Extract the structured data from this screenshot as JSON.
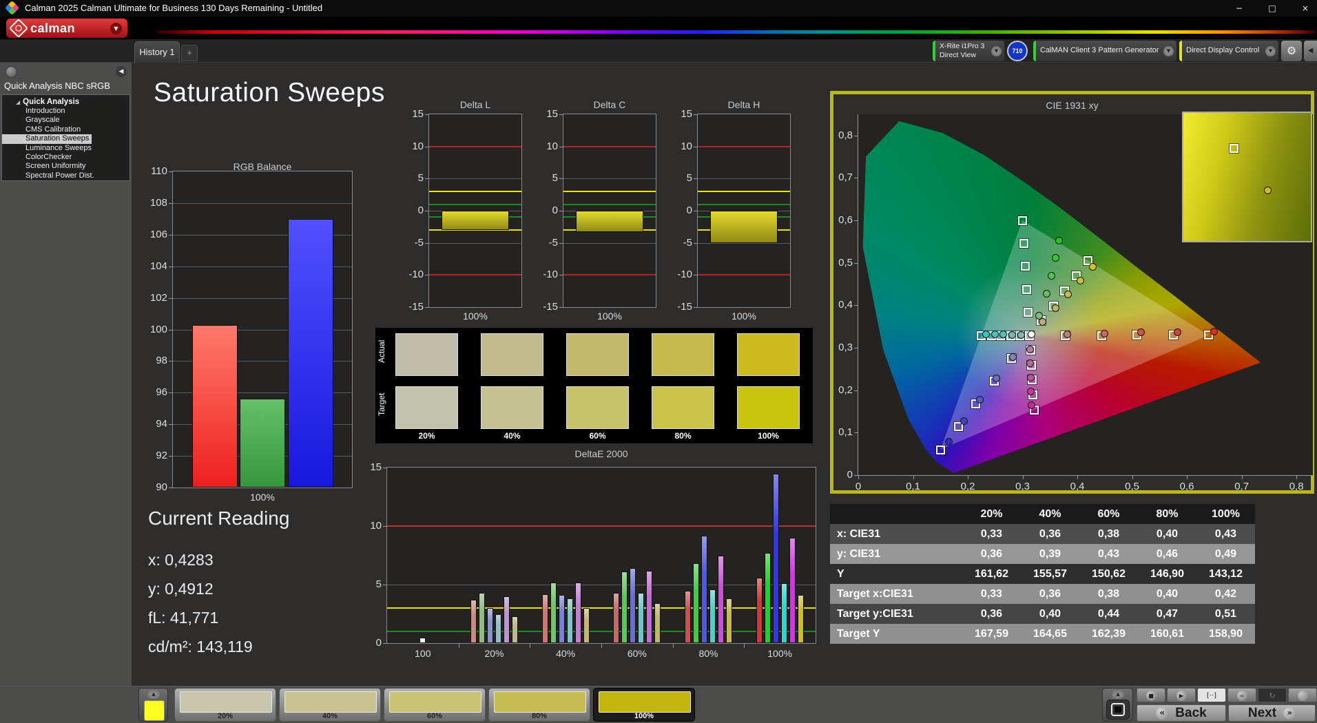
{
  "window": {
    "title": "Calman 2025 Calman Ultimate for Business 130 Days Remaining  - Untitled",
    "controls": {
      "minimize": "−",
      "maximize": "□",
      "close": "×"
    }
  },
  "brand": {
    "logo_text": "calman",
    "dropdown": "▼"
  },
  "toolbar": {
    "tab": "History 1",
    "tab_add": "+",
    "meter": {
      "line1": "X-Rite i1Pro 3",
      "line2": "Direct View",
      "accent": "#2fd32f",
      "dropdown": "▼"
    },
    "meter_badge": "710",
    "source": {
      "label": "CalMAN Client 3 Pattern Generator",
      "accent": "#2fd32f",
      "dropdown": "▼"
    },
    "display": {
      "label": "Direct Display Control",
      "accent": "#e3e32b",
      "dropdown": "▼"
    },
    "gear": "⚙",
    "edge_arrow": "◀"
  },
  "sidebar": {
    "collapse_arrow": "◀",
    "workflow_title": "Quick Analysis NBC sRGB",
    "root": "Quick Analysis",
    "items": [
      {
        "label": "Introduction",
        "selected": false
      },
      {
        "label": "Grayscale",
        "selected": false
      },
      {
        "label": "CMS Calibration",
        "selected": false
      },
      {
        "label": "Saturation Sweeps",
        "selected": true
      },
      {
        "label": "Luminance Sweeps",
        "selected": false
      },
      {
        "label": "ColorChecker",
        "selected": false
      },
      {
        "label": "Screen Uniformity",
        "selected": false
      },
      {
        "label": "Spectral Power Dist.",
        "selected": false
      }
    ]
  },
  "page": {
    "title": "Saturation Sweeps"
  },
  "current_reading": {
    "heading": "Current Reading",
    "lines": [
      "x: 0,4283",
      "y: 0,4912",
      "fL: 41,771",
      "cd/m²: 143,119"
    ]
  },
  "swatch_matrix": {
    "row_labels": [
      "Actual",
      "Target"
    ],
    "column_labels": [
      "20%",
      "40%",
      "60%",
      "80%",
      "100%"
    ],
    "actual_colors": [
      "#c0bda6",
      "#c2bc8d",
      "#c3b86a",
      "#c6ba4c",
      "#ccb91f"
    ],
    "target_colors": [
      "#c4c3ac",
      "#c5c192",
      "#c7c36a",
      "#cac44a",
      "#c9c40e"
    ]
  },
  "table": {
    "columns": [
      "20%",
      "40%",
      "60%",
      "80%",
      "100%"
    ],
    "rows": [
      {
        "label": "x: CIE31",
        "values": [
          "0,33",
          "0,36",
          "0,38",
          "0,40",
          "0,43"
        ],
        "bg": "#4d4d4d"
      },
      {
        "label": "y: CIE31",
        "values": [
          "0,36",
          "0,39",
          "0,43",
          "0,46",
          "0,49"
        ],
        "bg": "#969696"
      },
      {
        "label": "Y",
        "values": [
          "161,62",
          "155,57",
          "150,62",
          "146,90",
          "143,12"
        ],
        "bg": "#2e2e2e"
      },
      {
        "label": "Target x:CIE31",
        "values": [
          "0,33",
          "0,36",
          "0,38",
          "0,40",
          "0,42"
        ],
        "bg": "#8f8f8f"
      },
      {
        "label": "Target y:CIE31",
        "values": [
          "0,36",
          "0,40",
          "0,44",
          "0,47",
          "0,51"
        ],
        "bg": "#454545"
      },
      {
        "label": "Target Y",
        "values": [
          "167,59",
          "164,65",
          "162,39",
          "160,61",
          "158,90"
        ],
        "bg": "#909090"
      }
    ]
  },
  "chart_data": [
    {
      "id": "rgb_balance",
      "type": "bar",
      "title": "RGB Balance",
      "xlabel": "100%",
      "categories": [
        "Red",
        "Green",
        "Blue"
      ],
      "values": [
        100.3,
        95.6,
        107.0
      ],
      "bar_gradients": [
        [
          "#ff7a6a",
          "#ee2020"
        ],
        [
          "#64c06a",
          "#35983c"
        ],
        [
          "#5050ff",
          "#1818dd"
        ]
      ],
      "ylim": [
        90,
        110
      ],
      "ytick_step": 2
    },
    {
      "id": "delta_l",
      "type": "bar",
      "title": "Delta L",
      "xlabel": "100%",
      "categories": [
        "100%"
      ],
      "values": [
        -3.0
      ],
      "ylim": [
        -15,
        15
      ],
      "ytick_step": 5,
      "limit_lines": [
        {
          "value": 10,
          "color": "#b42525"
        },
        {
          "value": -10,
          "color": "#b42525"
        },
        {
          "value": 3,
          "color": "#e8e500"
        },
        {
          "value": -3,
          "color": "#e8e500"
        },
        {
          "value": 1,
          "color": "#1d8a1d"
        },
        {
          "value": -1,
          "color": "#1d8a1d"
        }
      ],
      "bar_gradient": [
        "#e3da2c",
        "#8f8a14"
      ]
    },
    {
      "id": "delta_c",
      "type": "bar",
      "title": "Delta C",
      "xlabel": "100%",
      "categories": [
        "100%"
      ],
      "values": [
        -3.3
      ],
      "ylim": [
        -15,
        15
      ],
      "ytick_step": 5,
      "limit_lines": [
        {
          "value": 10,
          "color": "#b42525"
        },
        {
          "value": -10,
          "color": "#b42525"
        },
        {
          "value": 3,
          "color": "#e8e500"
        },
        {
          "value": -3,
          "color": "#e8e500"
        },
        {
          "value": 1,
          "color": "#1d8a1d"
        },
        {
          "value": -1,
          "color": "#1d8a1d"
        }
      ],
      "bar_gradient": [
        "#e3da2c",
        "#8f8a14"
      ]
    },
    {
      "id": "delta_h",
      "type": "bar",
      "title": "Delta H",
      "xlabel": "100%",
      "categories": [
        "100%"
      ],
      "values": [
        -5.0
      ],
      "ylim": [
        -15,
        15
      ],
      "ytick_step": 5,
      "limit_lines": [
        {
          "value": 10,
          "color": "#b42525"
        },
        {
          "value": -10,
          "color": "#b42525"
        },
        {
          "value": 3,
          "color": "#e8e500"
        },
        {
          "value": -3,
          "color": "#e8e500"
        },
        {
          "value": 1,
          "color": "#1d8a1d"
        },
        {
          "value": -1,
          "color": "#1d8a1d"
        }
      ],
      "bar_gradient": [
        "#e3da2c",
        "#8f8a14"
      ]
    },
    {
      "id": "deltae2000",
      "type": "grouped-bar",
      "title": "DeltaE 2000",
      "ylim": [
        0,
        15
      ],
      "yticks": [
        0,
        5,
        10,
        15
      ],
      "limit_lines": [
        {
          "value": 10,
          "color": "#c03030"
        },
        {
          "value": 3,
          "color": "#e8e500"
        },
        {
          "value": 1,
          "color": "#1d8a1d"
        }
      ],
      "series_names": [
        "Red",
        "Green",
        "Blue",
        "Cyan",
        "Magenta",
        "Yellow"
      ],
      "groups": [
        {
          "label": "100",
          "values": [
            0.5
          ],
          "colors": [
            "#f2f2f2"
          ]
        },
        {
          "label": "20%",
          "values": [
            3.7,
            4.3,
            3.0,
            2.5,
            4.0,
            2.3
          ],
          "colors": [
            "#c28b84",
            "#8fba86",
            "#8b93c6",
            "#97bcc2",
            "#b797c6",
            "#bcb78f"
          ]
        },
        {
          "label": "40%",
          "values": [
            4.2,
            5.2,
            4.1,
            3.8,
            5.2,
            3.0
          ],
          "colors": [
            "#c67a76",
            "#77c070",
            "#7a82cf",
            "#82c2c6",
            "#bf82cf",
            "#bfb77a"
          ]
        },
        {
          "label": "60%",
          "values": [
            4.3,
            6.1,
            6.4,
            4.3,
            6.2,
            3.4
          ],
          "colors": [
            "#cb6663",
            "#5ac759",
            "#666fd9",
            "#68c9cb",
            "#c868d8",
            "#c3b860"
          ]
        },
        {
          "label": "80%",
          "values": [
            4.5,
            6.8,
            9.2,
            4.6,
            7.5,
            3.8
          ],
          "colors": [
            "#d04f4e",
            "#3bce3f",
            "#4f58e4",
            "#4bd0d0",
            "#d14de2",
            "#c8ba43"
          ]
        },
        {
          "label": "100%",
          "values": [
            5.6,
            7.7,
            14.5,
            5.1,
            9.0,
            4.1
          ],
          "colors": [
            "#d63636",
            "#1ad522",
            "#3336ef",
            "#2bd7d6",
            "#da2fec",
            "#cdbc22"
          ]
        }
      ]
    },
    {
      "id": "cie1931",
      "type": "scatter",
      "title": "CIE 1931 xy",
      "xlim": [
        0,
        0.83
      ],
      "ylim": [
        0,
        0.85
      ],
      "xtick_vals": [
        0,
        0.1,
        0.2,
        0.3,
        0.4,
        0.5,
        0.6,
        0.7,
        0.8
      ],
      "xtick_labels": [
        "0",
        "0,1",
        "0,2",
        "0,3",
        "0,4",
        "0,5",
        "0,6",
        "0,7",
        "0,8"
      ],
      "ytick_vals": [
        0,
        0.1,
        0.2,
        0.3,
        0.4,
        0.5,
        0.6,
        0.7,
        0.8
      ],
      "ytick_labels": [
        "0",
        "0,1",
        "0,2",
        "0,3",
        "0,4",
        "0,5",
        "0,6",
        "0,7",
        "0,8"
      ],
      "white_point": [
        0.313,
        0.329
      ],
      "gamut_triangle": [
        [
          0.64,
          0.33
        ],
        [
          0.3,
          0.6
        ],
        [
          0.15,
          0.06
        ]
      ],
      "locus": [
        [
          0.1741,
          0.005
        ],
        [
          0.144,
          0.0297
        ],
        [
          0.1241,
          0.0578
        ],
        [
          0.0913,
          0.1327
        ],
        [
          0.0454,
          0.295
        ],
        [
          0.0082,
          0.5384
        ],
        [
          0.0139,
          0.7502
        ],
        [
          0.0743,
          0.8338
        ],
        [
          0.1547,
          0.8059
        ],
        [
          0.2296,
          0.7543
        ],
        [
          0.3016,
          0.6923
        ],
        [
          0.3731,
          0.6245
        ],
        [
          0.4441,
          0.5547
        ],
        [
          0.5125,
          0.4866
        ],
        [
          0.5752,
          0.4242
        ],
        [
          0.627,
          0.3725
        ],
        [
          0.6915,
          0.3083
        ],
        [
          0.7347,
          0.2653
        ]
      ],
      "targets": [
        [
          0.313,
          0.329
        ],
        [
          0.378,
          0.329
        ],
        [
          0.444,
          0.329
        ],
        [
          0.509,
          0.33
        ],
        [
          0.575,
          0.33
        ],
        [
          0.64,
          0.33
        ],
        [
          0.31,
          0.383
        ],
        [
          0.308,
          0.437
        ],
        [
          0.305,
          0.492
        ],
        [
          0.303,
          0.546
        ],
        [
          0.3,
          0.6
        ],
        [
          0.28,
          0.275
        ],
        [
          0.248,
          0.221
        ],
        [
          0.215,
          0.168
        ],
        [
          0.183,
          0.114
        ],
        [
          0.15,
          0.06
        ],
        [
          0.295,
          0.329
        ],
        [
          0.278,
          0.329
        ],
        [
          0.26,
          0.329
        ],
        [
          0.243,
          0.329
        ],
        [
          0.225,
          0.329
        ],
        [
          0.315,
          0.294
        ],
        [
          0.316,
          0.259
        ],
        [
          0.318,
          0.224
        ],
        [
          0.319,
          0.189
        ],
        [
          0.321,
          0.154
        ],
        [
          0.334,
          0.364
        ],
        [
          0.356,
          0.399
        ],
        [
          0.377,
          0.434
        ],
        [
          0.398,
          0.47
        ],
        [
          0.419,
          0.505
        ]
      ],
      "measurements": [
        {
          "xy": [
            0.316,
            0.331
          ],
          "color": "#ffffff"
        },
        {
          "xy": [
            0.382,
            0.332
          ],
          "color": "#c47d72"
        },
        {
          "xy": [
            0.45,
            0.334
          ],
          "color": "#c86a5e"
        },
        {
          "xy": [
            0.516,
            0.336
          ],
          "color": "#cc574a"
        },
        {
          "xy": [
            0.583,
            0.337
          ],
          "color": "#d04436"
        },
        {
          "xy": [
            0.649,
            0.338
          ],
          "color": "#d43122"
        },
        {
          "xy": [
            0.33,
            0.376
          ],
          "color": "#86b878"
        },
        {
          "xy": [
            0.344,
            0.428
          ],
          "color": "#6cbc60"
        },
        {
          "xy": [
            0.353,
            0.47
          ],
          "color": "#52c148"
        },
        {
          "xy": [
            0.36,
            0.512
          ],
          "color": "#38c530"
        },
        {
          "xy": [
            0.367,
            0.552
          ],
          "color": "#1eca18"
        },
        {
          "xy": [
            0.282,
            0.278
          ],
          "color": "#8486b2"
        },
        {
          "xy": [
            0.252,
            0.228
          ],
          "color": "#6d70b8"
        },
        {
          "xy": [
            0.222,
            0.178
          ],
          "color": "#565abe"
        },
        {
          "xy": [
            0.193,
            0.128
          ],
          "color": "#3f44c4"
        },
        {
          "xy": [
            0.165,
            0.078
          ],
          "color": "#282eca"
        },
        {
          "xy": [
            0.297,
            0.33
          ],
          "color": "#88b4ae"
        },
        {
          "xy": [
            0.281,
            0.33
          ],
          "color": "#72b9b2"
        },
        {
          "xy": [
            0.265,
            0.331
          ],
          "color": "#5cbfb7"
        },
        {
          "xy": [
            0.249,
            0.331
          ],
          "color": "#46c4bb"
        },
        {
          "xy": [
            0.233,
            0.332
          ],
          "color": "#30cabf"
        },
        {
          "xy": [
            0.314,
            0.296
          ],
          "color": "#b37fa0"
        },
        {
          "xy": [
            0.314,
            0.263
          ],
          "color": "#b8699e"
        },
        {
          "xy": [
            0.315,
            0.23
          ],
          "color": "#bd539c"
        },
        {
          "xy": [
            0.315,
            0.197
          ],
          "color": "#c23d9a"
        },
        {
          "xy": [
            0.316,
            0.164
          ],
          "color": "#c72798"
        },
        {
          "xy": [
            0.337,
            0.361
          ],
          "color": "#b9b072"
        },
        {
          "xy": [
            0.36,
            0.393
          ],
          "color": "#bfb55e"
        },
        {
          "xy": [
            0.383,
            0.426
          ],
          "color": "#c5ba4a"
        },
        {
          "xy": [
            0.406,
            0.458
          ],
          "color": "#cbbf36"
        },
        {
          "xy": [
            0.428,
            0.491
          ],
          "color": "#d1c422"
        }
      ],
      "inset": {
        "square": [
          0.4,
          0.28
        ],
        "circle": [
          0.66,
          0.6
        ],
        "circle_color": "#cdbc22"
      }
    }
  ],
  "bottom": {
    "patterns": [
      {
        "label": "20%",
        "color": "#c9c6ad",
        "selected": false
      },
      {
        "label": "40%",
        "color": "#c9c391",
        "selected": false
      },
      {
        "label": "60%",
        "color": "#c9c273",
        "selected": false
      },
      {
        "label": "80%",
        "color": "#c5bd52",
        "selected": false
      },
      {
        "label": "100%",
        "color": "#c3b70d",
        "selected": true
      }
    ],
    "transport": {
      "stop": "■",
      "play": "▶",
      "pattern_window": "[··]",
      "loop": "∞",
      "refresh": "↻"
    },
    "back_label": "Back",
    "next_label": "Next",
    "back_arrow": "«",
    "next_arrow": "»",
    "up_arrow": "▲"
  }
}
